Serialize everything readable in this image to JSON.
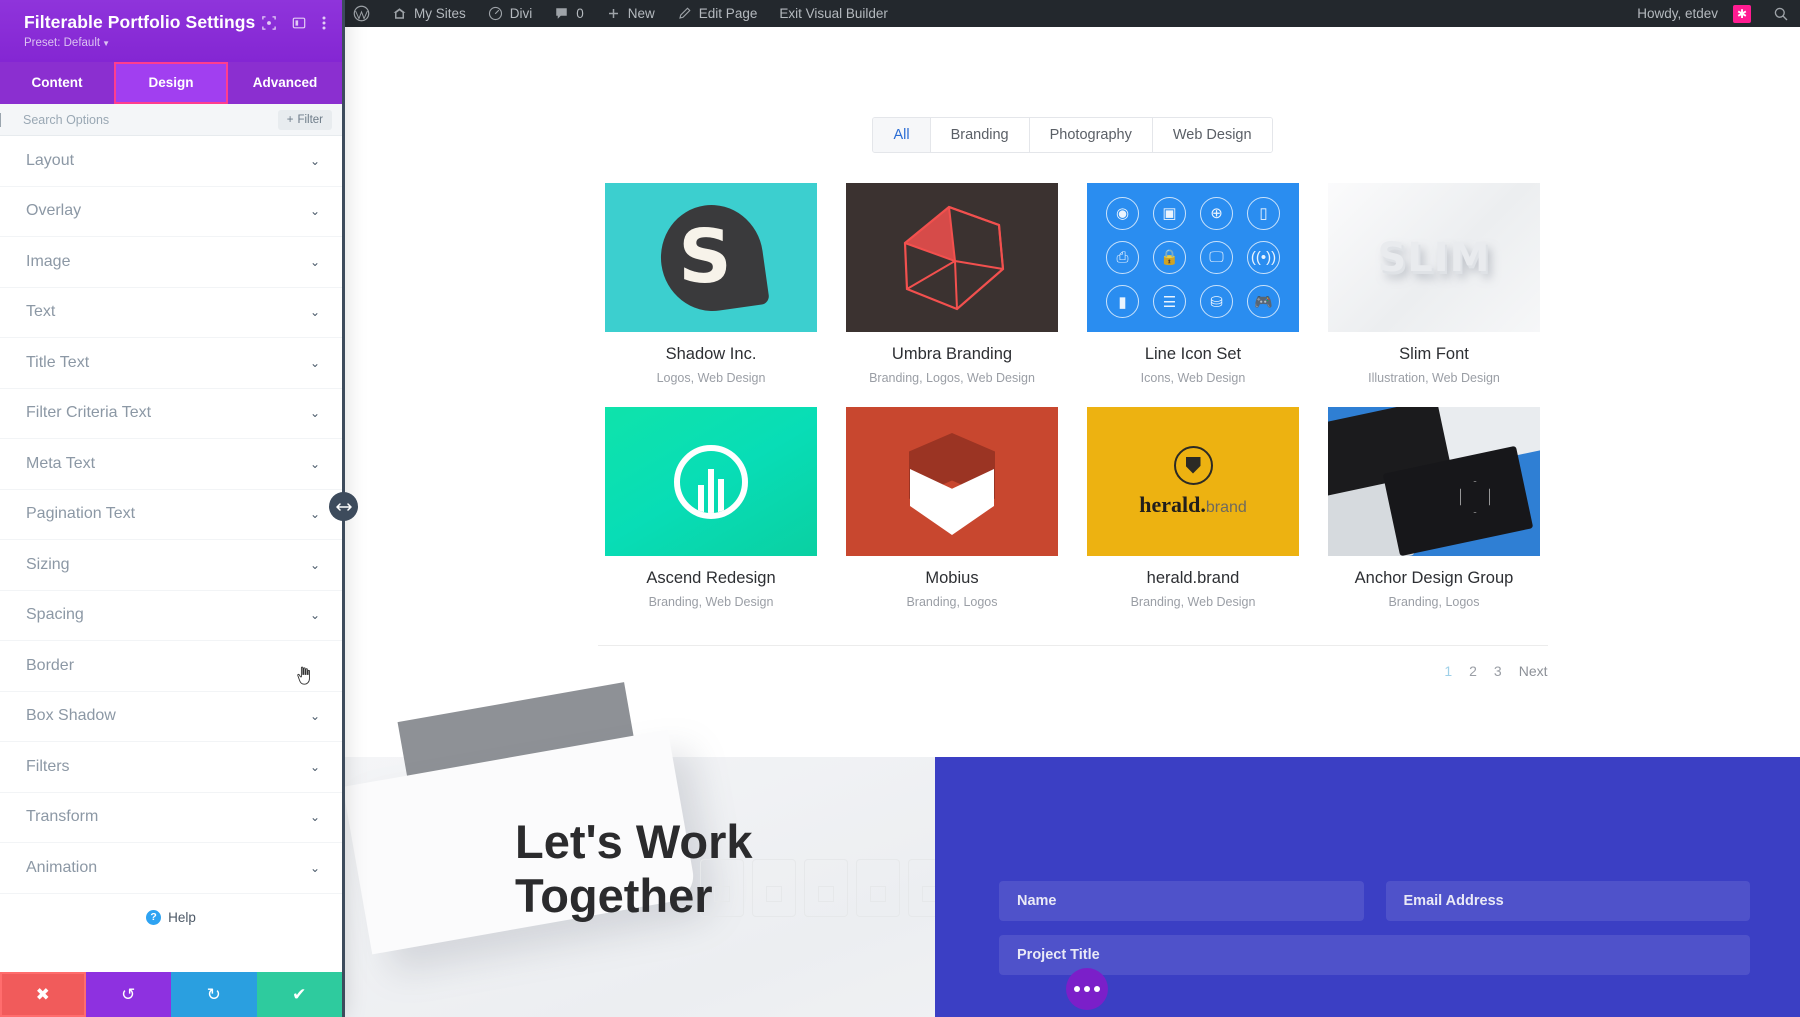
{
  "adminbar": {
    "items": [
      {
        "icon": "wordpress-icon",
        "label": ""
      },
      {
        "icon": "sites-icon",
        "label": "My Sites"
      },
      {
        "icon": "divi-icon",
        "label": "Divi"
      },
      {
        "icon": "comment-icon",
        "label": "0"
      },
      {
        "icon": "plus-icon",
        "label": "New"
      },
      {
        "icon": "pencil-icon",
        "label": "Edit Page"
      },
      {
        "icon": "",
        "label": "Exit Visual Builder"
      }
    ],
    "howdy": "Howdy, etdev",
    "search_icon": "search-icon"
  },
  "panel": {
    "title": "Filterable Portfolio Settings",
    "preset": "Preset: Default",
    "header_icons": [
      "target-icon",
      "layout-icon",
      "kebab-menu-icon"
    ],
    "tabs": [
      {
        "label": "Content",
        "active": false
      },
      {
        "label": "Design",
        "active": true
      },
      {
        "label": "Advanced",
        "active": false
      }
    ],
    "search": {
      "value": "",
      "placeholder": "Search Options"
    },
    "filter_button": "Filter",
    "options": [
      "Layout",
      "Overlay",
      "Image",
      "Text",
      "Title Text",
      "Filter Criteria Text",
      "Meta Text",
      "Pagination Text",
      "Sizing",
      "Spacing",
      "Border",
      "Box Shadow",
      "Filters",
      "Transform",
      "Animation"
    ],
    "help_label": "Help",
    "actions": [
      {
        "name": "cancel",
        "icon": "close-icon"
      },
      {
        "name": "undo",
        "icon": "undo-icon"
      },
      {
        "name": "redo",
        "icon": "redo-icon"
      },
      {
        "name": "save",
        "icon": "check-icon"
      }
    ]
  },
  "portfolio": {
    "filters": [
      {
        "label": "All",
        "active": true
      },
      {
        "label": "Branding",
        "active": false
      },
      {
        "label": "Photography",
        "active": false
      },
      {
        "label": "Web Design",
        "active": false
      }
    ],
    "items": [
      {
        "title": "Shadow Inc.",
        "meta": "Logos, Web Design",
        "art": "shadow"
      },
      {
        "title": "Umbra Branding",
        "meta": "Branding, Logos, Web Design",
        "art": "umbra"
      },
      {
        "title": "Line Icon Set",
        "meta": "Icons, Web Design",
        "art": "icons"
      },
      {
        "title": "Slim Font",
        "meta": "Illustration, Web Design",
        "art": "slim"
      },
      {
        "title": "Ascend Redesign",
        "meta": "Branding, Web Design",
        "art": "ascend"
      },
      {
        "title": "Mobius",
        "meta": "Branding, Logos",
        "art": "mobius"
      },
      {
        "title": "herald.brand",
        "meta": "Branding, Web Design",
        "art": "herald"
      },
      {
        "title": "Anchor Design Group",
        "meta": "Branding, Logos",
        "art": "anchor"
      }
    ],
    "pagination": [
      {
        "label": "1",
        "state": "current"
      },
      {
        "label": "2",
        "state": "link"
      },
      {
        "label": "3",
        "state": "link"
      },
      {
        "label": "Next",
        "state": "next"
      }
    ]
  },
  "cta": {
    "title": "Let's Work Together",
    "form_fields": [
      {
        "label": "Name",
        "full": false
      },
      {
        "label": "Email Address",
        "full": false
      },
      {
        "label": "Project Title",
        "full": true
      }
    ]
  },
  "fab": {
    "icon": "ellipsis-icon"
  },
  "colors": {
    "divi_purple": "#8b2fd0",
    "active_tab": "#a13ff0",
    "highlight_pink": "#ff3d8e",
    "adminbar": "#23282d",
    "form_blue": "#3b3fc4",
    "save_green": "#2ecb9e",
    "cancel_red": "#f15b5b",
    "redo_blue": "#2a9fe0"
  }
}
